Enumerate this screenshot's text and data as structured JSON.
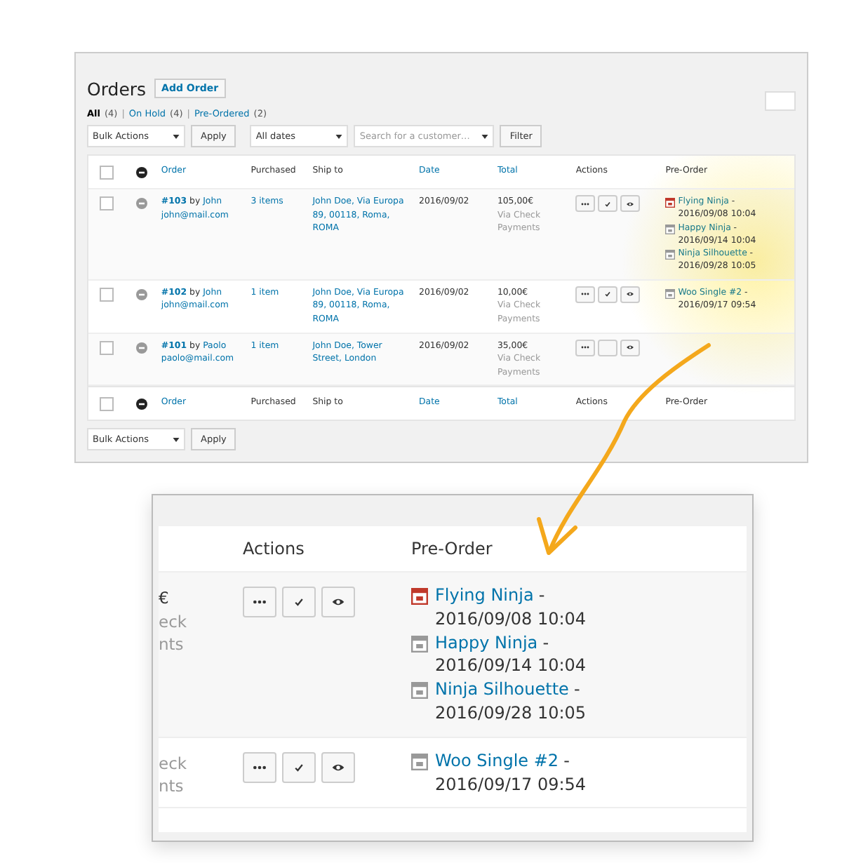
{
  "page": {
    "title": "Orders",
    "add_button": "Add Order"
  },
  "filters": [
    {
      "label": "All",
      "count": "(4)",
      "selected": true
    },
    {
      "label": "On Hold",
      "count": "(4)",
      "selected": false
    },
    {
      "label": "Pre-Ordered",
      "count": "(2)",
      "selected": false
    }
  ],
  "filter_separator": "|",
  "toolbar": {
    "bulk_actions": "Bulk Actions",
    "apply": "Apply",
    "dates": "All dates",
    "customer_placeholder": "Search for a customer…",
    "filter": "Filter"
  },
  "header_checkbox": {
    "checked": false
  },
  "columns": [
    {
      "label": "Order",
      "sortable": true
    },
    {
      "label": "Purchased",
      "sortable": false
    },
    {
      "label": "Ship to",
      "sortable": false
    },
    {
      "label": "Date",
      "sortable": true
    },
    {
      "label": "Total",
      "sortable": true
    },
    {
      "label": "Actions",
      "sortable": false
    },
    {
      "label": "Pre-Order",
      "sortable": false
    }
  ],
  "rows": [
    {
      "checked": false,
      "order_number": "#103",
      "by": "by",
      "customer": "John",
      "email": "john@mail.com",
      "purchased": "3 items",
      "ship_to": "John Doe, Via Europa 89, 00118, Roma, ROMA",
      "date": "2016/09/02",
      "total": "105,00€",
      "payment": "Via Check Payments",
      "actions": [
        {
          "kind": "more"
        },
        {
          "kind": "complete"
        },
        {
          "kind": "view"
        }
      ],
      "pre_orders": [
        {
          "product": "Flying Ninja",
          "dash": "-",
          "date": "2016/09/08 10:04",
          "color": "#c0392b"
        },
        {
          "product": "Happy Ninja",
          "dash": "-",
          "date": "2016/09/14 10:04",
          "color": "#999999"
        },
        {
          "product": "Ninja Silhouette",
          "dash": "-",
          "date": "2016/09/28 10:05",
          "color": "#999999"
        }
      ]
    },
    {
      "checked": false,
      "order_number": "#102",
      "by": "by",
      "customer": "John",
      "email": "john@mail.com",
      "purchased": "1 item",
      "ship_to": "John Doe, Via Europa 89, 00118, Roma, ROMA",
      "date": "2016/09/02",
      "total": "10,00€",
      "payment": "Via Check Payments",
      "actions": [
        {
          "kind": "more"
        },
        {
          "kind": "complete"
        },
        {
          "kind": "view"
        }
      ],
      "pre_orders": [
        {
          "product": "Woo Single #2",
          "dash": "-",
          "date": "2016/09/17 09:54",
          "color": "#999999"
        }
      ]
    },
    {
      "checked": false,
      "order_number": "#101",
      "by": "by",
      "customer": "Paolo",
      "email": "paolo@mail.com",
      "purchased": "1 item",
      "ship_to": "John Doe, Tower Street, London",
      "date": "2016/09/02",
      "total": "35,00€",
      "payment": "Via Check Payments",
      "actions": [
        {
          "kind": "more"
        },
        {
          "kind": "empty"
        },
        {
          "kind": "view"
        }
      ],
      "pre_orders": []
    }
  ],
  "footer_checkbox": {
    "checked": false
  },
  "footer_columns": [
    {
      "label": "Order",
      "sortable": true
    },
    {
      "label": "Purchased",
      "sortable": false
    },
    {
      "label": "Ship to",
      "sortable": false
    },
    {
      "label": "Date",
      "sortable": true
    },
    {
      "label": "Total",
      "sortable": true
    },
    {
      "label": "Actions",
      "sortable": false
    },
    {
      "label": "Pre-Order",
      "sortable": false
    }
  ],
  "bottom_toolbar": {
    "bulk_actions": "Bulk Actions",
    "apply": "Apply"
  },
  "inset": {
    "columns": [
      "Actions",
      "Pre-Order"
    ],
    "rows": [
      {
        "total_fragments": [
          "€",
          "eck",
          "nts"
        ],
        "actions": [
          {
            "kind": "more"
          },
          {
            "kind": "complete"
          },
          {
            "kind": "view"
          }
        ],
        "pre_orders": [
          {
            "product": "Flying Ninja",
            "dash": "-",
            "date": "2016/09/08 10:04",
            "color": "#c0392b"
          },
          {
            "product": "Happy Ninja",
            "dash": "-",
            "date": "2016/09/14 10:04",
            "color": "#999999"
          },
          {
            "product": "Ninja Silhouette",
            "dash": "-",
            "date": "2016/09/28 10:05",
            "color": "#999999"
          }
        ]
      },
      {
        "total_fragments": [
          "eck",
          "nts"
        ],
        "actions": [
          {
            "kind": "more"
          },
          {
            "kind": "complete"
          },
          {
            "kind": "view"
          }
        ],
        "pre_orders": [
          {
            "product": "Woo Single #2",
            "dash": "-",
            "date": "2016/09/17 09:54",
            "color": "#999999"
          }
        ]
      }
    ]
  }
}
